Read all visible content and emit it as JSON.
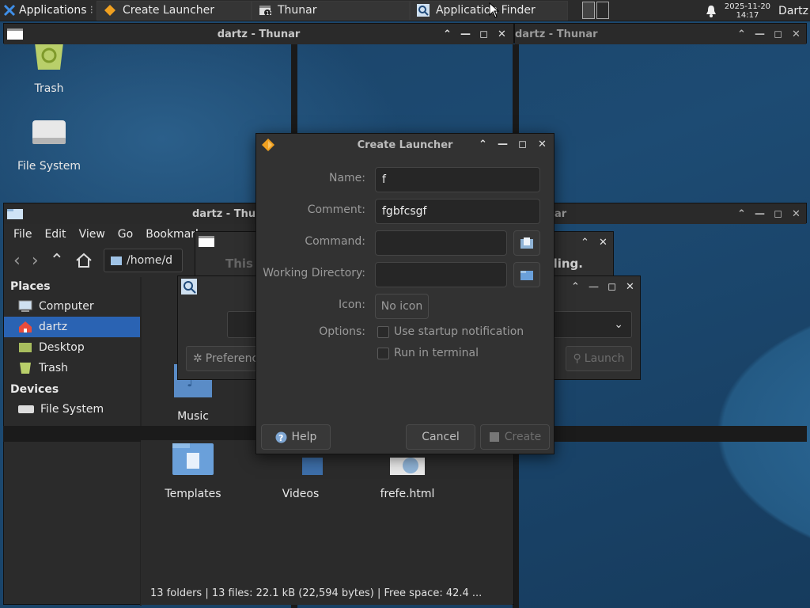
{
  "panel": {
    "applications_label": "Applications",
    "tasks": [
      {
        "label": "Create Launcher"
      },
      {
        "label": "Thunar"
      },
      {
        "label": "Application Finder"
      }
    ],
    "clock_date": "2025-11-20",
    "clock_time": "14:17",
    "user": "Dartz"
  },
  "desktop": {
    "icons": [
      {
        "label": "Trash"
      },
      {
        "label": "File System"
      }
    ]
  },
  "thunar_top": {
    "title": "dartz - Thunar",
    "title_right": "dartz - Thunar"
  },
  "thunar_main": {
    "title": "dartz - Thunar",
    "menu": [
      "File",
      "Edit",
      "View",
      "Go",
      "Bookmarks"
    ],
    "path": "/home/d",
    "places_header": "Places",
    "places": [
      "Computer",
      "dartz",
      "Desktop",
      "Trash"
    ],
    "devices_header": "Devices",
    "devices": [
      "File System"
    ],
    "files": [
      {
        "label": "Music"
      },
      {
        "label": "Templates"
      },
      {
        "label": "Videos"
      },
      {
        "label": "frefe.html"
      }
    ],
    "status": "13 folders  |  13 files: 22.1 kB (22,594 bytes)  |  Free space: 42.4 ...",
    "right_title_fragment": "dartz - Thunar"
  },
  "bg_dialog": {
    "text_left": "This",
    "text_right": "ling."
  },
  "appfinder": {
    "preferences_label": "Preferences",
    "launch_label": "Launch"
  },
  "dialog": {
    "title": "Create Launcher",
    "labels": {
      "name": "Name:",
      "comment": "Comment:",
      "command": "Command:",
      "working_directory": "Working Directory:",
      "icon": "Icon:",
      "options": "Options:"
    },
    "values": {
      "name": "f",
      "comment": "fgbfcsgf",
      "command": "",
      "working_directory": ""
    },
    "icon_button": "No icon",
    "options": {
      "startup_notification": "Use startup notification",
      "run_in_terminal": "Run in terminal"
    },
    "buttons": {
      "help": "Help",
      "cancel": "Cancel",
      "create": "Create"
    }
  }
}
